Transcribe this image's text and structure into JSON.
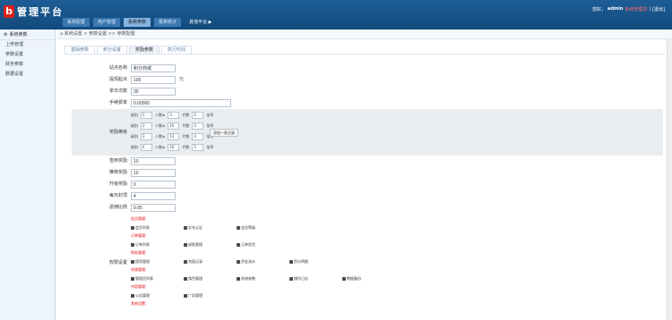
{
  "header": {
    "logo": "b",
    "title": "管理平台",
    "user_prefix": "您好，",
    "user": "admin",
    "red_text": "系统管理员",
    "sep": "|",
    "logout": "[退出]"
  },
  "nav": {
    "tabs": [
      "系统配置",
      "用户管理",
      "系统参数",
      "报表统计",
      "其他平台 ▶"
    ],
    "active": 2
  },
  "sidebar": {
    "title": "系统参数",
    "items": [
      "上传管理",
      "参数设置",
      "财务参数",
      "数据设置"
    ]
  },
  "breadcrumb": "系统设置 > 参数设置 >> 参数配置",
  "subtabs": [
    "基础参数",
    "积分设置",
    "奖励参数",
    "执行时间"
  ],
  "form": {
    "site_name": {
      "label": "站点名称",
      "value": "积分商城"
    },
    "min_amount": {
      "label": "提现起点",
      "value": "100",
      "suffix": "元"
    },
    "max_count": {
      "label": "单日次数",
      "value": "30"
    },
    "fee": {
      "label": "手续费率",
      "value": "0.00000"
    },
    "level_label": "奖励等级",
    "levels": [
      {
        "a": "1",
        "b": "3",
        "c": "2"
      },
      {
        "a": "2",
        "b": "10",
        "c": "3"
      },
      {
        "a": "3",
        "b": "12",
        "c": "4"
      },
      {
        "a": "4",
        "b": "10",
        "c": "5"
      }
    ],
    "level_words": {
      "l": "级别",
      "p": "人数≥",
      "g": "代数",
      "r": "倍率"
    },
    "add_btn": "添加一条记录",
    "r1": {
      "label": "签到奖励",
      "value": "10"
    },
    "r2": {
      "label": "推荐奖励",
      "value": "10"
    },
    "r3": {
      "label": "升级奖励",
      "value": "0"
    },
    "r4": {
      "label": "每日封顶",
      "value": "4"
    },
    "r5": {
      "label": "返佣比例",
      "value": "0.05"
    },
    "perm_label": "权限设置",
    "groups": [
      {
        "title": "会员管理：",
        "items": [
          "会员列表",
          "实名认证",
          "会员等级"
        ]
      },
      {
        "title": "订单管理：",
        "items": [
          "订单列表",
          "退款管理",
          "订单发货"
        ]
      },
      {
        "title": "财务管理：",
        "items": [
          "提现管理",
          "充值记录",
          "资金流水",
          "积分明细"
        ]
      },
      {
        "title": "系统管理：",
        "items": [
          "管理员列表",
          "角色管理",
          "系统参数",
          "操作日志",
          "数据备份"
        ]
      },
      {
        "title": "内容管理：",
        "items": [
          "公告管理",
          "广告管理"
        ]
      },
      {
        "title": "其他设置：",
        "items": []
      }
    ]
  }
}
